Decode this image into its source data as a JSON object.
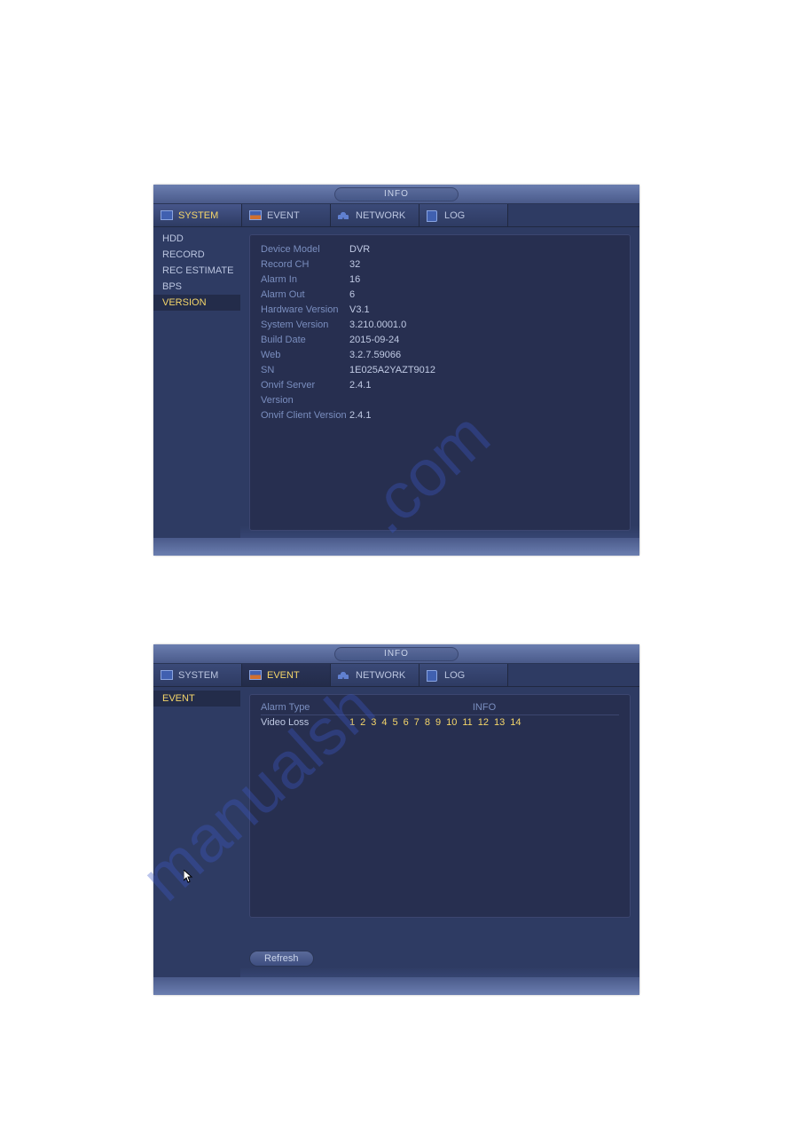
{
  "watermark": ".com",
  "watermark2": "manualsh",
  "window1": {
    "title": "INFO",
    "tabs": {
      "system": "SYSTEM",
      "event": "EVENT",
      "network": "NETWORK",
      "log": "LOG"
    },
    "sidebar": {
      "hdd": "HDD",
      "record": "RECORD",
      "recestimate": "REC ESTIMATE",
      "bps": "BPS",
      "version": "VERSION"
    },
    "version": {
      "device_model_l": "Device Model",
      "device_model_v": "DVR",
      "record_ch_l": "Record CH",
      "record_ch_v": "32",
      "alarm_in_l": "Alarm In",
      "alarm_in_v": "16",
      "alarm_out_l": "Alarm Out",
      "alarm_out_v": "6",
      "hw_l": "Hardware Version",
      "hw_v": "V3.1",
      "sys_l": "System Version",
      "sys_v": "3.210.0001.0",
      "build_l": "Build Date",
      "build_v": "2015-09-24",
      "web_l": "Web",
      "web_v": "3.2.7.59066",
      "sn_l": "SN",
      "sn_v": "1E025A2YAZT9012",
      "onvif_s_l": "Onvif Server Version",
      "onvif_s_v": "2.4.1",
      "onvif_c_l": "Onvif Client Version",
      "onvif_c_v": "2.4.1"
    }
  },
  "window2": {
    "title": "INFO",
    "tabs": {
      "system": "SYSTEM",
      "event": "EVENT",
      "network": "NETWORK",
      "log": "LOG"
    },
    "sidebar": {
      "event": "EVENT"
    },
    "table": {
      "col_alarm": "Alarm Type",
      "col_info": "INFO",
      "row_type": "Video Loss",
      "n1": "1",
      "n2": "2",
      "n3": "3",
      "n4": "4",
      "n5": "5",
      "n6": "6",
      "n7": "7",
      "n8": "8",
      "n9": "9",
      "n10": "10",
      "n11": "11",
      "n12": "12",
      "n13": "13",
      "n14": "14"
    },
    "refresh": "Refresh"
  }
}
